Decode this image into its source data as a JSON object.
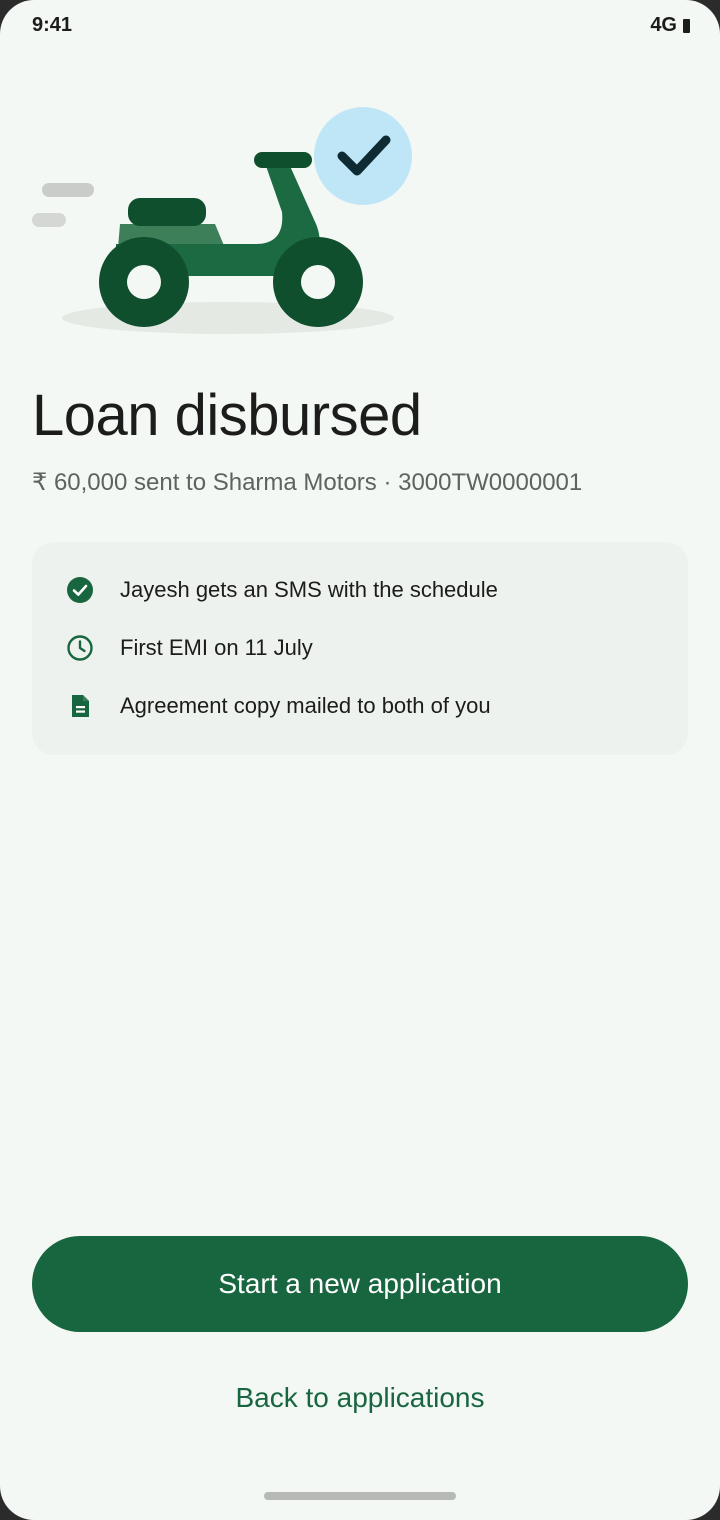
{
  "status_bar": {
    "time": "9:41",
    "network": "4G"
  },
  "hero": {
    "illustration": "scooter-with-checkmark",
    "colors": {
      "scooter": "#1b6a42",
      "scooter_dark": "#0f4f2d",
      "check_circle": "#bfe6f6"
    }
  },
  "header": {
    "title": "Loan disbursed",
    "subtitle": "₹ 60,000 sent to Sharma Motors · 3000TW0000001"
  },
  "info": {
    "items": [
      {
        "icon": "check-circle-icon",
        "text": "Jayesh gets an SMS with the schedule"
      },
      {
        "icon": "clock-icon",
        "text": "First EMI on 11 July"
      },
      {
        "icon": "document-icon",
        "text": "Agreement copy mailed to both of you"
      }
    ]
  },
  "actions": {
    "primary_label": "Start a new application",
    "secondary_label": "Back to applications"
  },
  "theme": {
    "accent": "#18663f",
    "background": "#f4f8f4",
    "card": "#eef2ee"
  }
}
